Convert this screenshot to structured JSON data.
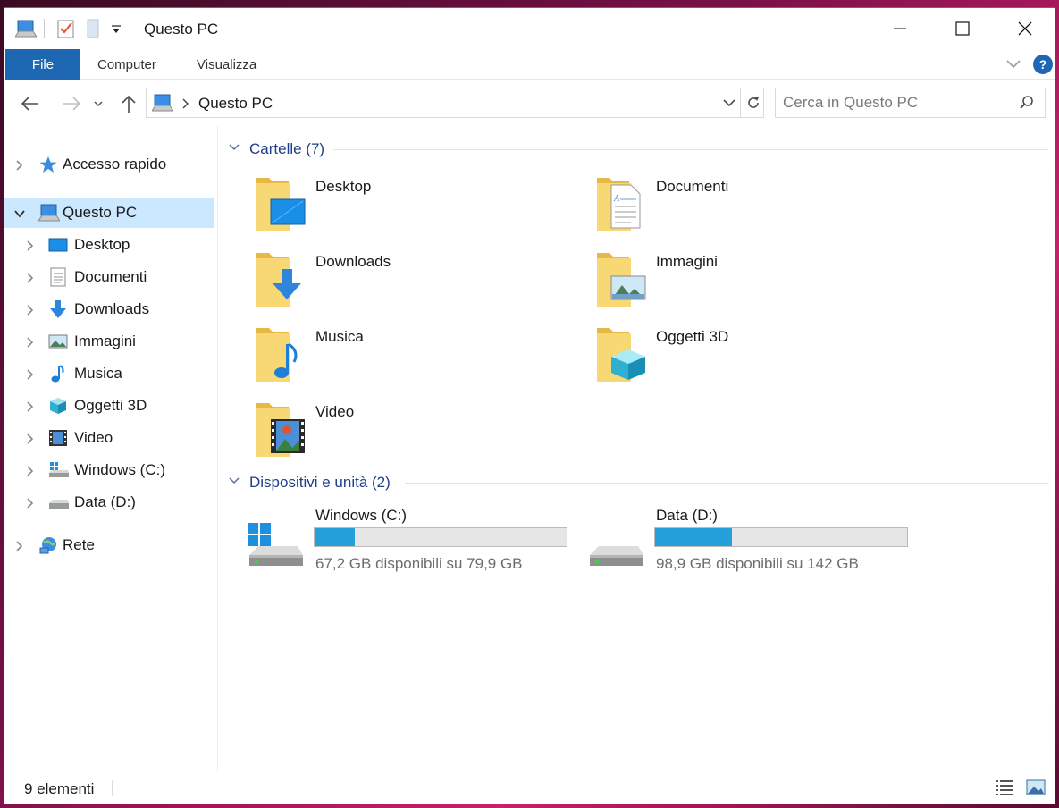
{
  "window": {
    "title": "Questo PC",
    "minimize_glyph": "—",
    "maximize_glyph": "☐",
    "close_glyph": "✕"
  },
  "ribbon": {
    "tabs": [
      "File",
      "Computer",
      "Visualizza"
    ],
    "help_label": "?"
  },
  "address": {
    "path": "Questo PC"
  },
  "search": {
    "placeholder": "Cerca in Questo PC"
  },
  "sidebar": {
    "items": [
      {
        "label": "Accesso rapido",
        "icon": "star-icon"
      },
      {
        "label": "Questo PC",
        "icon": "computer-icon"
      },
      {
        "label": "Desktop",
        "icon": "desktop-icon"
      },
      {
        "label": "Documenti",
        "icon": "documents-icon"
      },
      {
        "label": "Downloads",
        "icon": "downloads-icon"
      },
      {
        "label": "Immagini",
        "icon": "pictures-icon"
      },
      {
        "label": "Musica",
        "icon": "music-icon"
      },
      {
        "label": "Oggetti 3D",
        "icon": "3d-objects-icon"
      },
      {
        "label": "Video",
        "icon": "video-icon"
      },
      {
        "label": "Windows (C:)",
        "icon": "windows-drive-icon"
      },
      {
        "label": "Data (D:)",
        "icon": "drive-icon"
      },
      {
        "label": "Rete",
        "icon": "network-icon"
      }
    ]
  },
  "groups": {
    "folders": {
      "title": "Cartelle (7)",
      "items": [
        "Desktop",
        "Documenti",
        "Downloads",
        "Immagini",
        "Musica",
        "Oggetti 3D",
        "Video"
      ]
    },
    "devices": {
      "title": "Dispositivi e unità (2)",
      "items": [
        {
          "name": "Windows (C:)",
          "free_text": "67,2 GB disponibili su 79,9 GB",
          "used_fraction": 0.159
        },
        {
          "name": "Data (D:)",
          "free_text": "98,9 GB disponibili su 142 GB",
          "used_fraction": 0.304
        }
      ]
    }
  },
  "status": {
    "count_text": "9 elementi"
  },
  "colors": {
    "accent": "#1e68b3",
    "selected": "#cce8ff",
    "group_header": "#1e3f8a",
    "drive_bar": "#26a0da",
    "folder": "#f5c95a"
  }
}
